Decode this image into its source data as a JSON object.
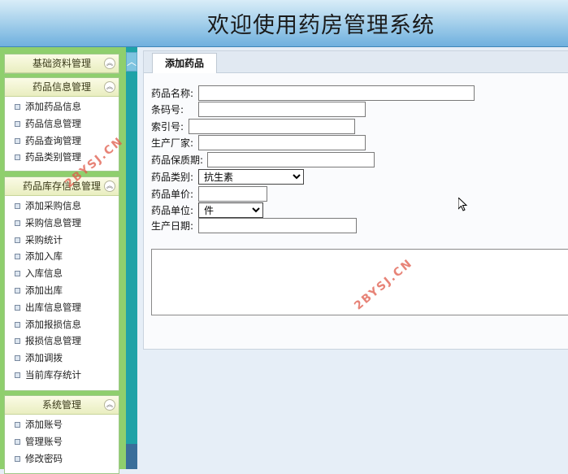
{
  "header": {
    "title": "欢迎使用药房管理系统"
  },
  "sidebar": {
    "groups": [
      {
        "title": "基础资料管理",
        "items": []
      },
      {
        "title": "药品信息管理",
        "items": [
          "添加药品信息",
          "药品信息管理",
          "药品查询管理",
          "药品类别管理"
        ]
      },
      {
        "title": "药品库存信息管理",
        "items": [
          "添加采购信息",
          "采购信息管理",
          "采购统计",
          "添加入库",
          "入库信息",
          "添加出库",
          "出库信息管理",
          "添加报损信息",
          "报损信息管理",
          "添加调拨",
          "当前库存统计"
        ]
      },
      {
        "title": "系统管理",
        "items": [
          "添加账号",
          "管理账号",
          "修改密码"
        ]
      }
    ]
  },
  "tab": {
    "label": "添加药品"
  },
  "form": {
    "name_label": "药品名称:",
    "barcode_label": "条码号:",
    "index_label": "索引号:",
    "maker_label": "生产厂家:",
    "shelf_label": "药品保质期:",
    "category_label": "药品类别:",
    "category_value": "抗生素",
    "price_label": "药品单价:",
    "unit_label": "药品单位:",
    "unit_value": "件",
    "date_label": "生产日期:",
    "name_value": "",
    "barcode_value": "",
    "index_value": "",
    "maker_value": "",
    "shelf_value": "",
    "price_value": "",
    "date_value": ""
  },
  "watermark": {
    "text": "2BYSJ.CN"
  },
  "icons": {
    "collapse": "collapse-up-icon",
    "scroll_up": "scroll-up-arrow-icon",
    "bullet": "square-bullet-icon",
    "cursor": "mouse-cursor-icon"
  }
}
